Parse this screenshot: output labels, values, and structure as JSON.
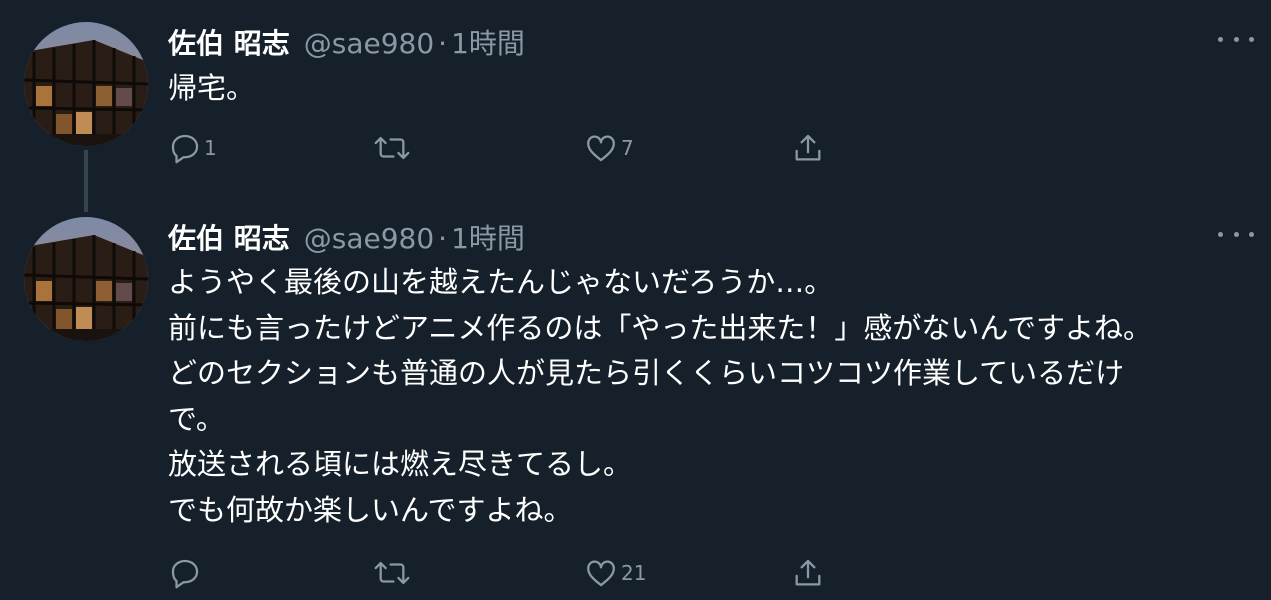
{
  "tweets": [
    {
      "author_name": "佐伯 昭志",
      "handle": "@sae980",
      "separator": "·",
      "time": "1時間",
      "text_lines": [
        "帰宅。"
      ],
      "reply_count": "1",
      "retweet_count": "",
      "like_count": "7"
    },
    {
      "author_name": "佐伯 昭志",
      "handle": "@sae980",
      "separator": "·",
      "time": "1時間",
      "text_lines": [
        "ようやく最後の山を越えたんじゃないだろうか…。",
        "前にも言ったけどアニメ作るのは「やった出来た！」感がないんですよね。",
        "どのセクションも普通の人が見たら引くくらいコツコツ作業しているだけ",
        "で。",
        "放送される頃には燃え尽きてるし。",
        "でも何故か楽しいんですよね。"
      ],
      "reply_count": "",
      "retweet_count": "",
      "like_count": "21"
    }
  ],
  "colors": {
    "background": "#15202b",
    "text_primary": "#ffffff",
    "text_secondary": "#8b98a5",
    "thread_line": "#38444d"
  },
  "icons": {
    "reply": "reply-icon",
    "retweet": "retweet-icon",
    "like": "heart-icon",
    "share": "share-icon",
    "more": "more-icon"
  }
}
